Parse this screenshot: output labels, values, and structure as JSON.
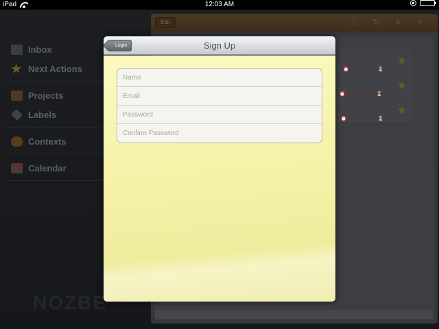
{
  "status_bar": {
    "device": "iPad",
    "time": "12:03 AM",
    "battery_level": 1.0
  },
  "background_app": {
    "sidebar": [
      {
        "label": "Inbox",
        "icon": "inbox-icon"
      },
      {
        "label": "Next Actions",
        "icon": "star-icon"
      },
      {
        "label": "Projects",
        "icon": "folder-icon"
      },
      {
        "label": "Labels",
        "icon": "tag-icon"
      },
      {
        "label": "Contexts",
        "icon": "trophy-icon"
      },
      {
        "label": "Calendar",
        "icon": "calendar-icon"
      }
    ],
    "toolbar": {
      "edit_label": "Edit"
    },
    "tasks": [
      {
        "date": "Sep 1, 2010",
        "duration": "4h"
      },
      {
        "date": "Aug 31, 2010",
        "duration": "5m"
      },
      {
        "date": "Aug 31, 2010",
        "duration": "1h"
      }
    ]
  },
  "modal": {
    "title": "Sign Up",
    "back_label": "Login",
    "fields": [
      {
        "placeholder": "Name",
        "value": ""
      },
      {
        "placeholder": "Email",
        "value": ""
      },
      {
        "placeholder": "Password",
        "value": ""
      },
      {
        "placeholder": "Confirm Password",
        "value": ""
      }
    ]
  }
}
